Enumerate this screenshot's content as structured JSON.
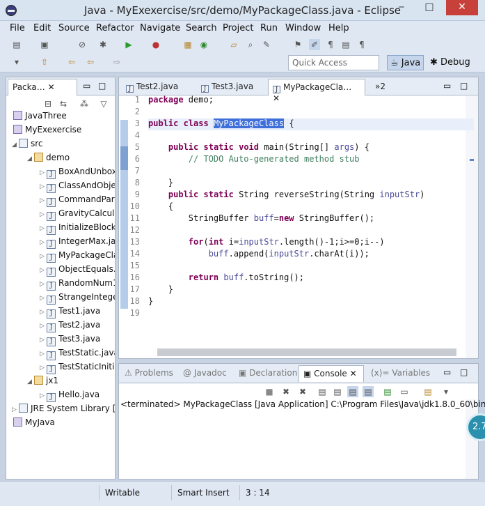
{
  "window": {
    "title": "Java - MyExexercise/src/demo/MyPackageClass.java - Eclipse",
    "min": "‒",
    "max": "□",
    "close": "✕"
  },
  "menu": [
    "File",
    "Edit",
    "Source",
    "Refactor",
    "Navigate",
    "Search",
    "Project",
    "Run",
    "Window",
    "Help"
  ],
  "quick_access": "Quick Access",
  "perspectives": {
    "java": "Java",
    "debug": "Debug"
  },
  "explorer": {
    "tab": "Packa…",
    "rows": [
      {
        "label": "JavaThree",
        "icon": "project-icon"
      },
      {
        "label": "MyExexercise",
        "icon": "project-icon"
      },
      {
        "label": "src",
        "icon": "folder-icon"
      },
      {
        "label": "demo",
        "icon": "package-icon"
      },
      {
        "label": "BoxAndUnbox",
        "icon": "java-file-icon"
      },
      {
        "label": "ClassAndObje",
        "icon": "java-file-icon"
      },
      {
        "label": "CommandPara",
        "icon": "java-file-icon"
      },
      {
        "label": "GravityCalcula",
        "icon": "java-file-icon"
      },
      {
        "label": "InitializeBlockl",
        "icon": "java-file-icon"
      },
      {
        "label": "IntegerMax.ja",
        "icon": "java-file-icon"
      },
      {
        "label": "MyPackageCla",
        "icon": "java-file-icon"
      },
      {
        "label": "ObjectEquals.j",
        "icon": "java-file-icon"
      },
      {
        "label": "RandomNum1",
        "icon": "java-file-icon"
      },
      {
        "label": "StrangeIntege",
        "icon": "java-file-icon"
      },
      {
        "label": "Test1.java",
        "icon": "java-file-icon"
      },
      {
        "label": "Test2.java",
        "icon": "java-file-icon"
      },
      {
        "label": "Test3.java",
        "icon": "java-file-icon"
      },
      {
        "label": "TestStatic.java",
        "icon": "java-file-icon"
      },
      {
        "label": "TestStaticIniti",
        "icon": "java-file-icon"
      },
      {
        "label": "jx1",
        "icon": "package-icon"
      },
      {
        "label": "Hello.java",
        "icon": "java-file-icon"
      },
      {
        "label": "JRE System Library [",
        "icon": "library-icon"
      },
      {
        "label": "MyJava",
        "icon": "project-icon"
      }
    ]
  },
  "editor": {
    "tabs": [
      "Test2.java",
      "Test3.java",
      "MyPackageCla…",
      "»2"
    ],
    "lines": [
      {
        "n": "1",
        "text": "package demo;"
      },
      {
        "n": "2",
        "text": ""
      },
      {
        "n": "3",
        "text": "public class MyPackageClass {"
      },
      {
        "n": "4",
        "text": ""
      },
      {
        "n": "5",
        "text": "    public static void main(String[] args) {"
      },
      {
        "n": "6",
        "text": "        // TODO Auto-generated method stub"
      },
      {
        "n": "7",
        "text": ""
      },
      {
        "n": "8",
        "text": "    }"
      },
      {
        "n": "9",
        "text": "    public static String reverseString(String inputStr)"
      },
      {
        "n": "10",
        "text": "    {"
      },
      {
        "n": "11",
        "text": "        StringBuffer buff=new StringBuffer();"
      },
      {
        "n": "12",
        "text": ""
      },
      {
        "n": "13",
        "text": "        for(int i=inputStr.length()-1;i>=0;i--)"
      },
      {
        "n": "14",
        "text": "            buff.append(inputStr.charAt(i));"
      },
      {
        "n": "15",
        "text": ""
      },
      {
        "n": "16",
        "text": "        return buff.toString();"
      },
      {
        "n": "17",
        "text": "    }"
      },
      {
        "n": "18",
        "text": "}"
      },
      {
        "n": "19",
        "text": ""
      }
    ]
  },
  "bottom": {
    "tabs": [
      "Problems",
      "Javadoc",
      "Declaration",
      "Console",
      "Variables"
    ],
    "console_text": "<terminated> MyPackageClass [Java Application] C:\\Program Files\\Java\\jdk1.8.0_60\\bin"
  },
  "status": {
    "writable": "Writable",
    "insert": "Smart Insert",
    "position": "3 : 14"
  },
  "badge": "2.7",
  "colors": {
    "keyword": "#7f0055",
    "comment": "#3f7f5f",
    "selection": "#3f6fd8"
  }
}
